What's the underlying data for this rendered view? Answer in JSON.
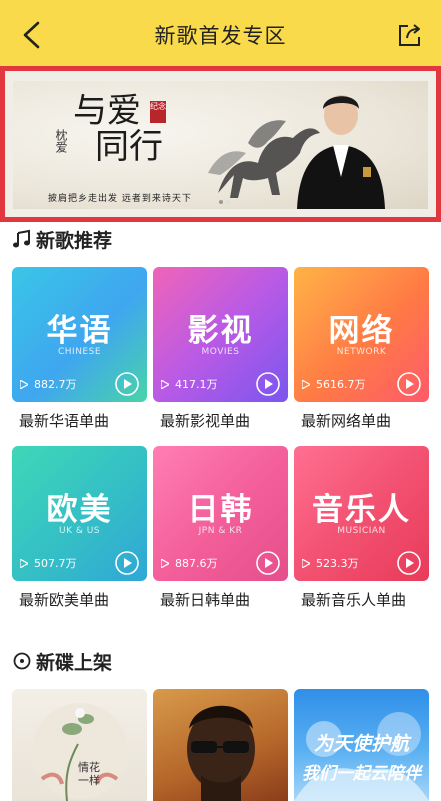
{
  "header": {
    "title": "新歌首发专区"
  },
  "banner": {
    "calligraphy_line1": "与爱",
    "calligraphy_line2": "同行",
    "small_text": "枕爱",
    "seal_text": "纪念",
    "tagline": "披肩把乡走出发  远者到来诗天下"
  },
  "new_songs": {
    "heading": "新歌推荐",
    "cards": [
      {
        "title": "华语",
        "subtitle": "CHINESE",
        "plays": "882.7万",
        "label": "最新华语单曲"
      },
      {
        "title": "影视",
        "subtitle": "MOVIES",
        "plays": "417.1万",
        "label": "最新影视单曲"
      },
      {
        "title": "网络",
        "subtitle": "NETWORK",
        "plays": "5616.7万",
        "label": "最新网络单曲"
      },
      {
        "title": "欧美",
        "subtitle": "UK & US",
        "plays": "507.7万",
        "label": "最新欧美单曲"
      },
      {
        "title": "日韩",
        "subtitle": "JPN & KR",
        "plays": "887.6万",
        "label": "最新日韩单曲"
      },
      {
        "title": "音乐人",
        "subtitle": "MUSICIAN",
        "plays": "523.3万",
        "label": "最新音乐人单曲"
      }
    ]
  },
  "new_albums": {
    "heading": "新碟上架",
    "albums": [
      {
        "cover_text": "情花一样"
      },
      {
        "cover_text": ""
      },
      {
        "cover_text_line1": "为天使护航",
        "cover_text_line2": "我们一起云陪伴"
      }
    ]
  },
  "colors": {
    "header_bg": "#f9da4b",
    "banner_border": "#e2373f"
  }
}
